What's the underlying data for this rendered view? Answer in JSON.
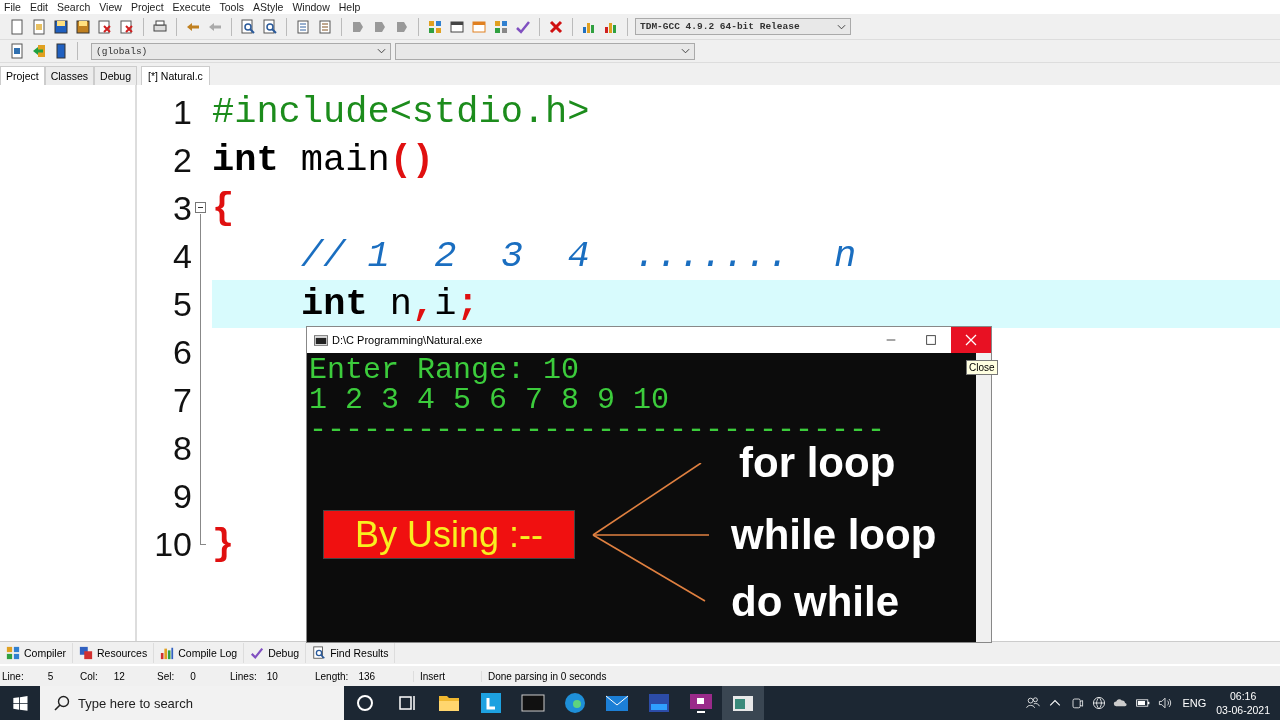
{
  "menu": [
    "File",
    "Edit",
    "Search",
    "View",
    "Project",
    "Execute",
    "Tools",
    "AStyle",
    "Window",
    "Help"
  ],
  "toolbar": {
    "compiler": "TDM-GCC 4.9.2 64-bit Release",
    "scope": "(globals)"
  },
  "side_tabs": [
    {
      "label": "Project",
      "selected": true
    },
    {
      "label": "Classes",
      "selected": false
    },
    {
      "label": "Debug",
      "selected": false
    }
  ],
  "editor_tabs": [
    {
      "label": "[*] Natural.c",
      "selected": true
    }
  ],
  "code_lines": [
    {
      "number": "1",
      "current": false,
      "tokens": [
        {
          "text": "#include<stdio.h>",
          "kind": "preproc"
        }
      ]
    },
    {
      "number": "2",
      "current": false,
      "tokens": [
        {
          "text": "int",
          "kind": "keyword"
        },
        {
          "text": " main",
          "kind": "plain"
        },
        {
          "text": "()",
          "kind": "symbol"
        }
      ]
    },
    {
      "number": "3",
      "current": false,
      "kind": "fold-start",
      "tokens": [
        {
          "text": "{",
          "kind": "symbol"
        }
      ]
    },
    {
      "number": "4",
      "current": false,
      "kind": "fold-line",
      "indented": true,
      "tokens": [
        {
          "text": "// 1  2  3  4  .......  n",
          "kind": "comment"
        }
      ]
    },
    {
      "number": "5",
      "current": true,
      "kind": "fold-line",
      "indented": true,
      "tokens": [
        {
          "text": "int",
          "kind": "keyword"
        },
        {
          "text": " n",
          "kind": "plain"
        },
        {
          "text": ",",
          "kind": "symbol"
        },
        {
          "text": "i",
          "kind": "plain"
        },
        {
          "text": ";",
          "kind": "symbol"
        }
      ]
    },
    {
      "number": "6",
      "current": false,
      "kind": "fold-line"
    },
    {
      "number": "7",
      "current": false,
      "kind": "fold-line"
    },
    {
      "number": "8",
      "current": false,
      "kind": "fold-line"
    },
    {
      "number": "9",
      "current": false,
      "kind": "fold-line"
    },
    {
      "number": "10",
      "current": false,
      "kind": "fold-end",
      "tokens": [
        {
          "text": "}",
          "kind": "symbol"
        }
      ]
    }
  ],
  "console": {
    "title": "D:\\C Programming\\Natural.exe",
    "tooltip": "Close",
    "output": [
      "Enter Range: 10",
      "1 2 3 4 5 6 7 8 9 10",
      "--------------------------------"
    ],
    "annotation": {
      "label": "By Using :--",
      "items": [
        "for loop",
        "while loop",
        "do while"
      ]
    }
  },
  "bottom_tabs": [
    "Compiler",
    "Resources",
    "Compile Log",
    "Debug",
    "Find Results"
  ],
  "status_bar": [
    {
      "label": "Line:",
      "value": "5"
    },
    {
      "label": "Col:",
      "value": "12"
    },
    {
      "label": "Sel:",
      "value": "0"
    },
    {
      "label": "Lines:",
      "value": "10"
    },
    {
      "label": "Length:",
      "value": "136"
    },
    {
      "value": "Insert"
    },
    {
      "value": "Done parsing in 0 seconds"
    }
  ],
  "taskbar": {
    "search_placeholder": "Type here to search",
    "language": "ENG",
    "time": "06:16",
    "date": "03-06-2021"
  }
}
